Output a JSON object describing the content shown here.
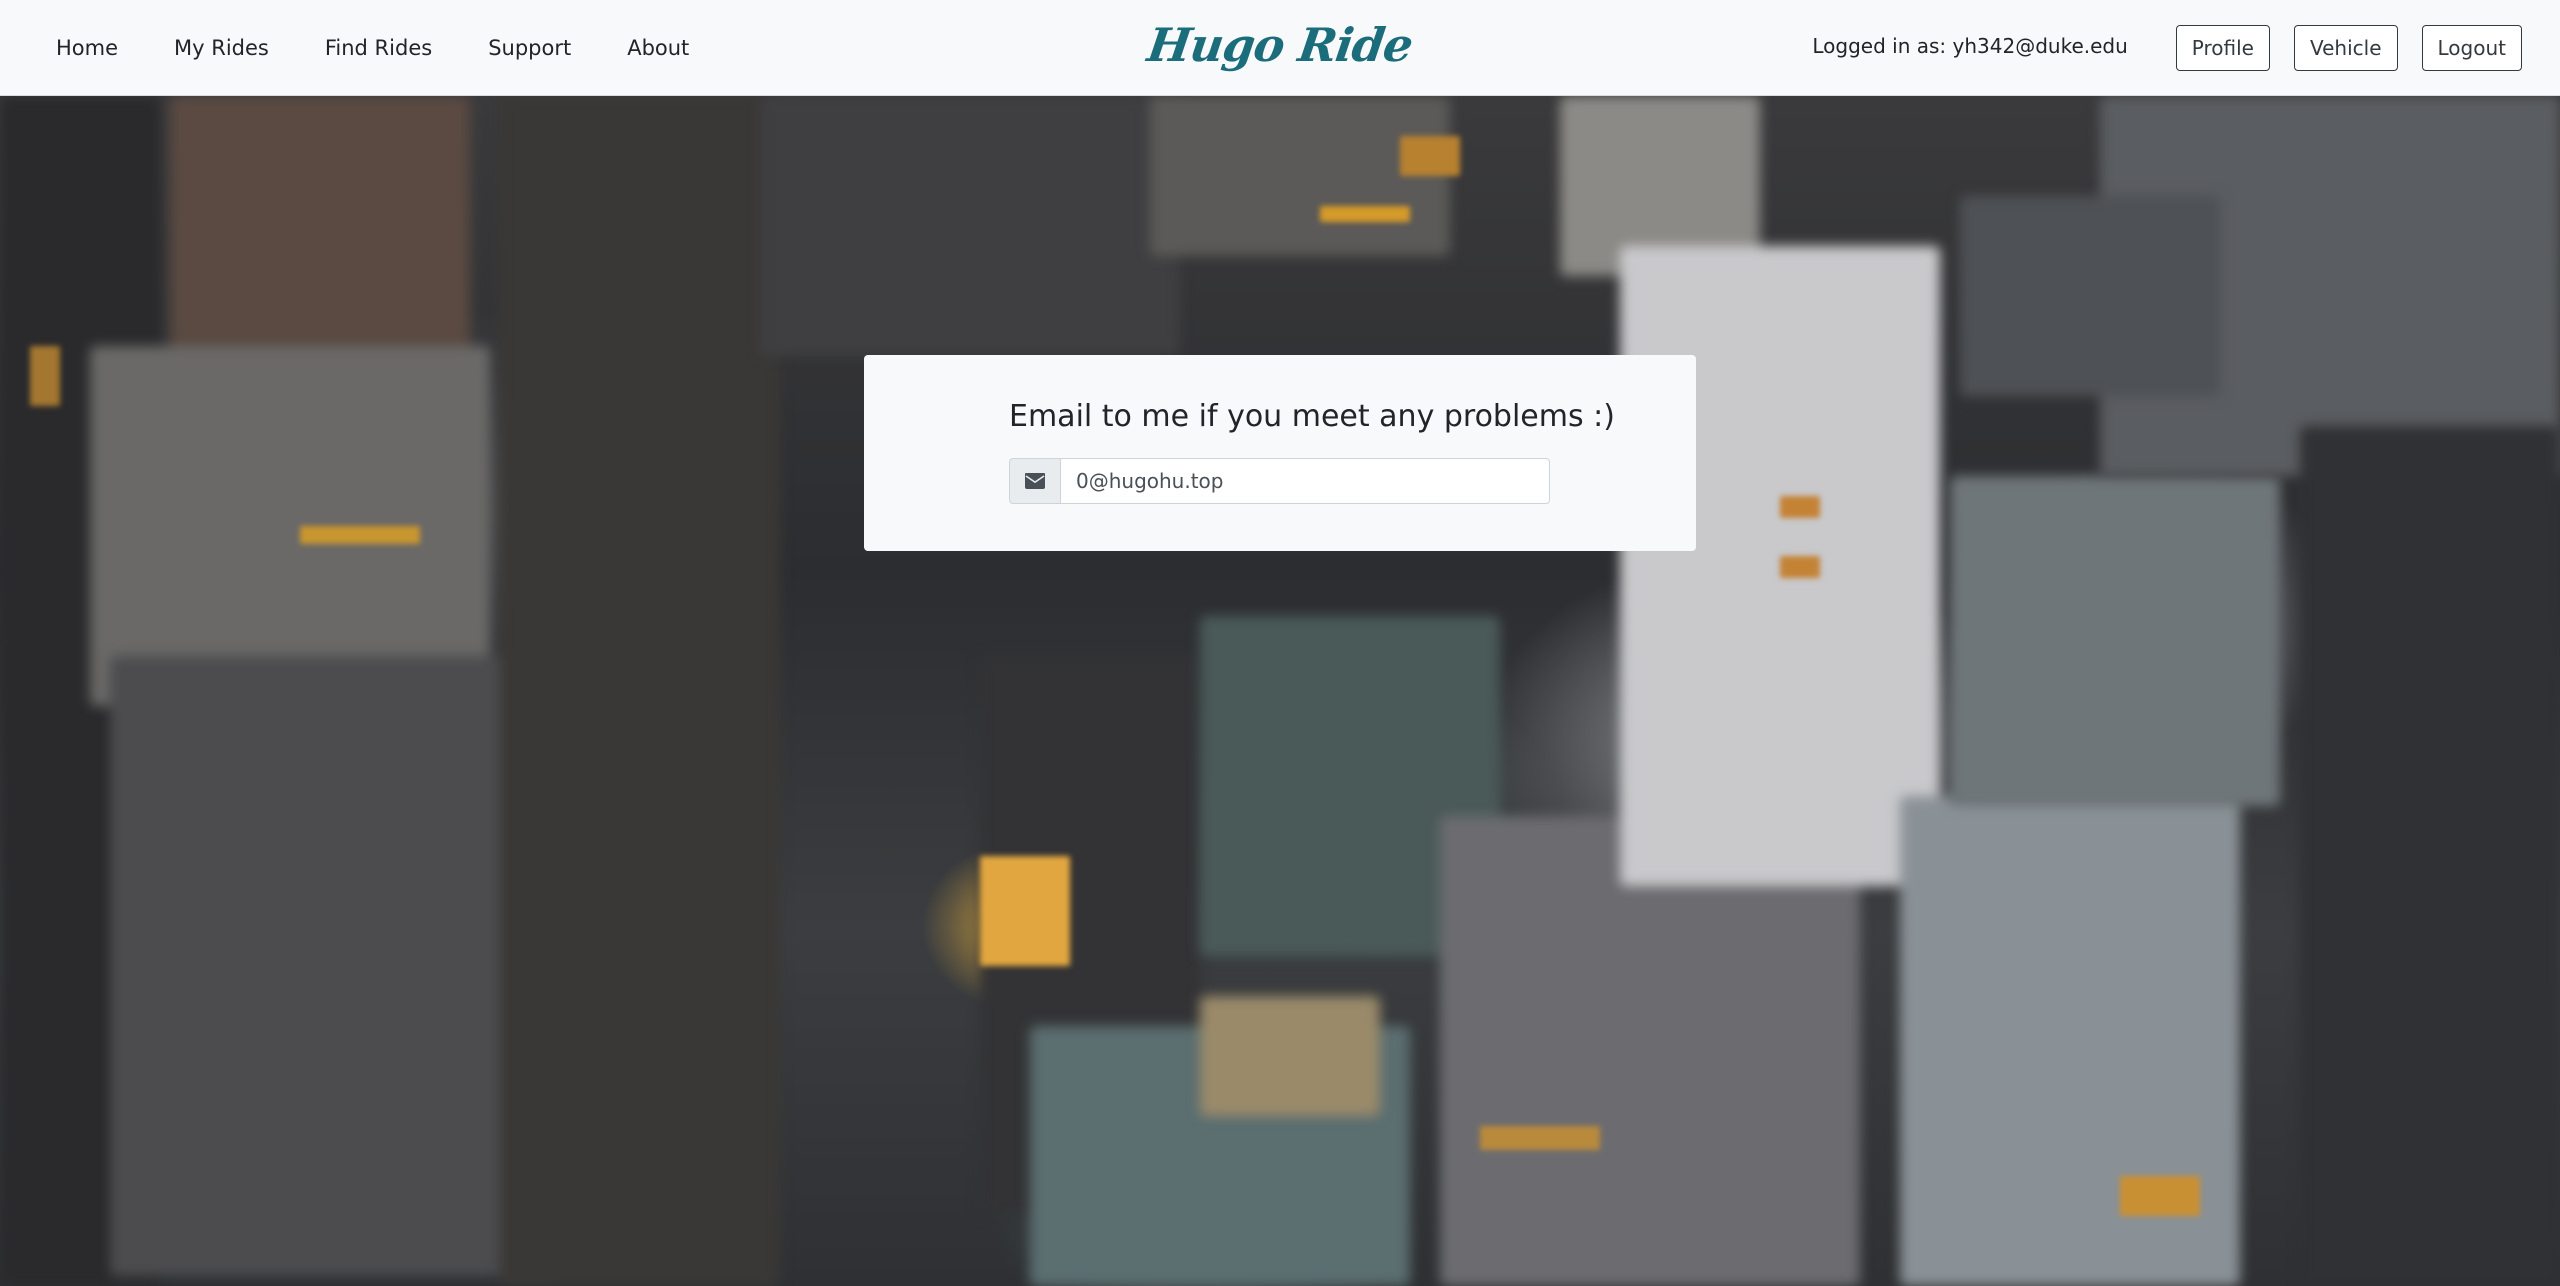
{
  "nav": {
    "links": [
      {
        "label": "Home"
      },
      {
        "label": "My Rides"
      },
      {
        "label": "Find Rides"
      },
      {
        "label": "Support"
      },
      {
        "label": "About"
      }
    ],
    "brand": "Hugo Ride",
    "logged_in_text": "Logged in as: yh342@duke.edu",
    "buttons": {
      "profile": "Profile",
      "vehicle": "Vehicle",
      "logout": "Logout"
    }
  },
  "support_card": {
    "title": "Email to me if you meet any problems :)",
    "email_icon": "envelope-icon",
    "email_value": "0@hugohu.top"
  },
  "colors": {
    "brand": "#1b6d7c",
    "navbar_bg": "#f8f9fa",
    "card_bg": "#f8f9fa",
    "text": "#212529"
  }
}
